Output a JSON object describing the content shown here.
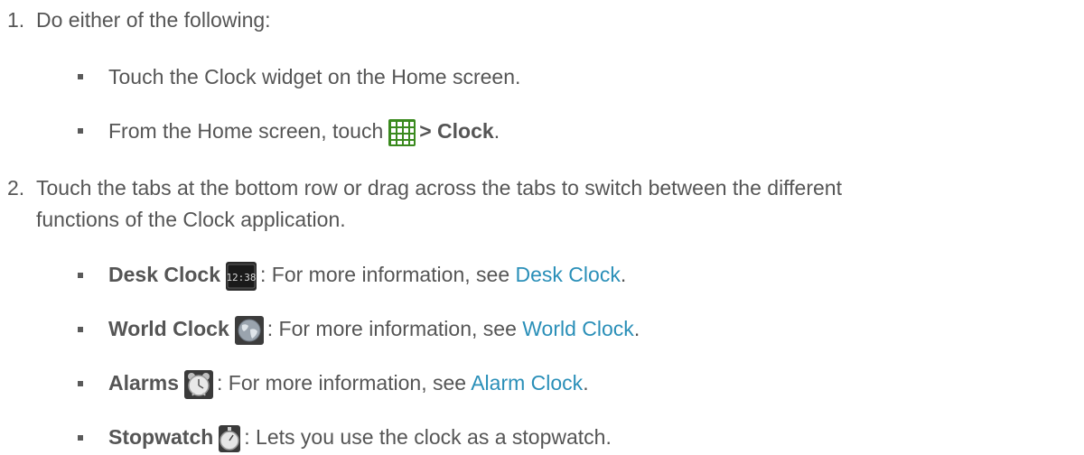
{
  "steps": [
    {
      "number": "1.",
      "text": "Do either of the following:",
      "bullets": [
        {
          "text": "Touch the Clock widget on the Home screen."
        },
        {
          "pre": "From the Home screen, touch",
          "icon": "apps-grid-icon",
          "bold": "> Clock",
          "post": "."
        }
      ]
    },
    {
      "number": "2.",
      "text_line1": "Touch the tabs at the bottom row or drag across the tabs to switch between the different",
      "text_line2": "functions of the Clock application.",
      "bullets": [
        {
          "label": "Desk Clock",
          "icon": "desk-clock-icon",
          "icon_text": "12:38",
          "pre_link": ": For more information, see ",
          "link": "Desk Clock",
          "post": "."
        },
        {
          "label": "World Clock",
          "icon": "globe-icon",
          "pre_link": ": For more information, see ",
          "link": "World Clock",
          "post": "."
        },
        {
          "label": "Alarms",
          "icon": "alarm-clock-icon",
          "pre_link": ": For more information, see ",
          "link": "Alarm Clock",
          "post": "."
        },
        {
          "label": "Stopwatch",
          "icon": "stopwatch-icon",
          "post": ": Lets you use the clock as a stopwatch."
        }
      ]
    }
  ],
  "colors": {
    "text": "#555555",
    "link": "#2a8fb8",
    "bullet": "#5a5a5a"
  }
}
